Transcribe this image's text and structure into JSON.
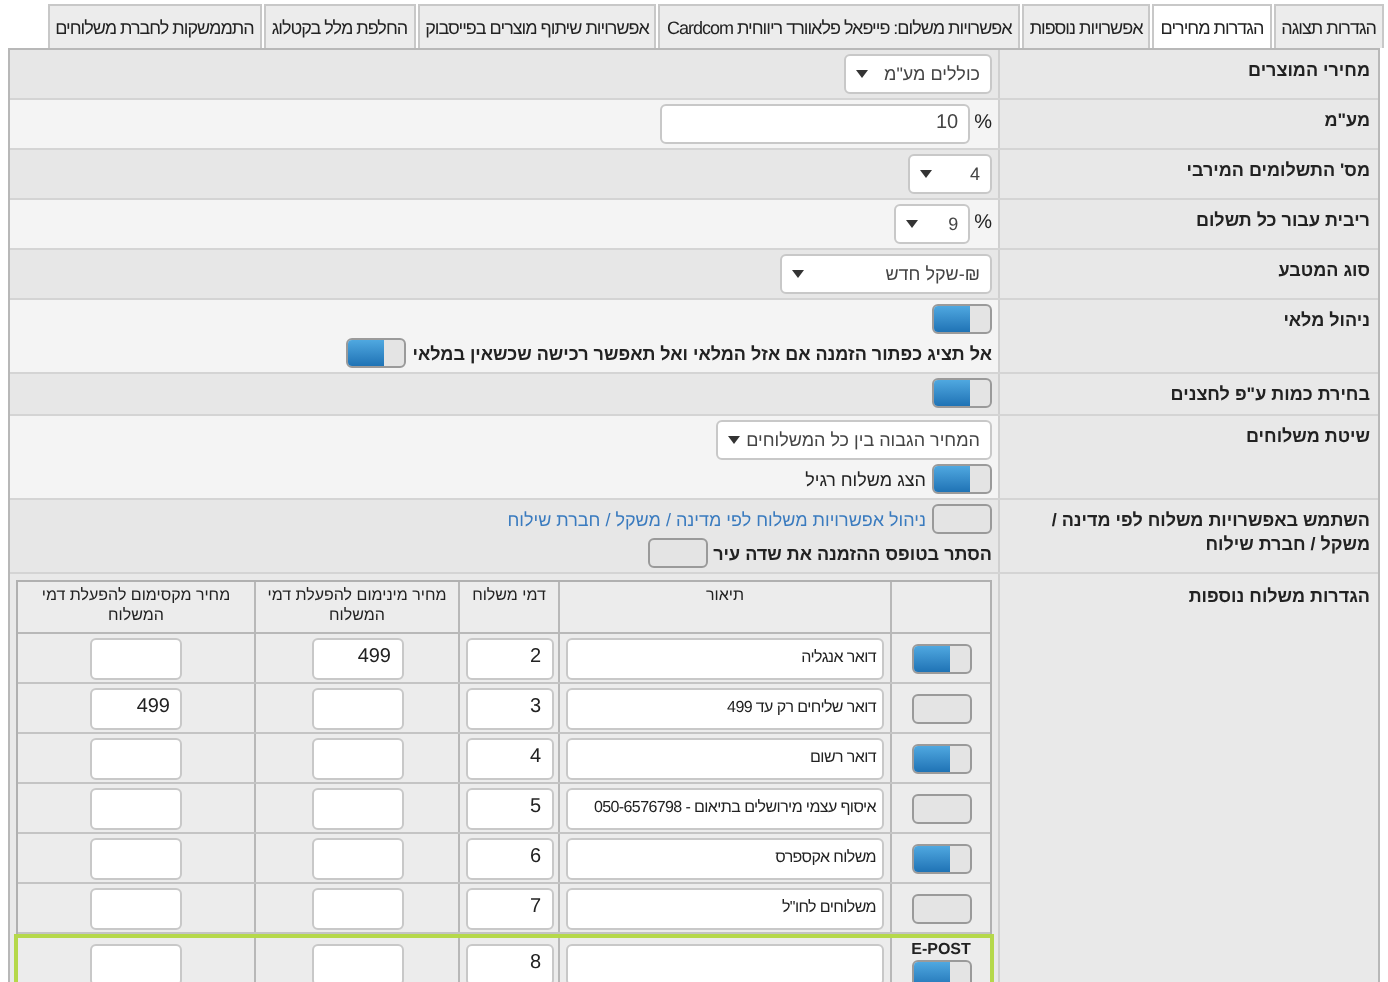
{
  "tabs": [
    {
      "label": "הגדרות תצוגה",
      "selected": false
    },
    {
      "label": "הגדרות מחירים",
      "selected": true
    },
    {
      "label": "אפשרויות נוספות",
      "selected": false
    },
    {
      "label": "אפשרויות משלום: פייפאל פלאוורד ריווחית Cardcom",
      "selected": false
    },
    {
      "label": "אפשרויות שיתוף מוצרים בפייסבוק",
      "selected": false
    },
    {
      "label": "החלפת מלל בקטלוג",
      "selected": false
    },
    {
      "label": "התממשקות לחברת משלוחים",
      "selected": false
    }
  ],
  "settings": [
    {
      "label": "מחירי המוצרים",
      "controls": [
        {
          "kind": "select",
          "value": "כוללים מע\"מ"
        }
      ]
    },
    {
      "label": "מע\"מ",
      "controls": [
        {
          "kind": "input",
          "value": "10",
          "unit": "%"
        }
      ]
    },
    {
      "label": "מס' התשלומים המירבי",
      "controls": [
        {
          "kind": "select",
          "value": "4"
        }
      ]
    },
    {
      "label": "ריבית עבור כל תשלום",
      "controls": [
        {
          "kind": "select",
          "value": "9",
          "unit": "%"
        }
      ]
    },
    {
      "label": "סוג המטבע",
      "controls": [
        {
          "kind": "select",
          "value": "₪-שקל חדש"
        }
      ]
    },
    {
      "label": "ניהול מלאי",
      "controls": [
        {
          "kind": "toggle",
          "on": true
        },
        {
          "kind": "text_toggle",
          "on": true,
          "text": "אל תציג כפתור הזמנה אם אזל המלאי ואל תאפשר רכישה שכשאין במלאי"
        }
      ]
    },
    {
      "label": "בחירת כמות ע\"פ לחצנים",
      "controls": [
        {
          "kind": "toggle",
          "on": true
        }
      ]
    },
    {
      "label": "שיטת משלוחים",
      "controls": [
        {
          "kind": "select",
          "value": "המחיר הגבוה בין כל המשלוחים"
        },
        {
          "kind": "toggle",
          "on": true,
          "text": "הצג משלוח רגיל"
        }
      ]
    },
    {
      "label": "השתמש באפשרויות משלוח לפי מדינה / משקל / חברת שילוח",
      "controls": [
        {
          "kind": "toggle",
          "on": false,
          "link": "ניהול אפשרויות משלוח לפי מדינה / משקל / חברת שילוח"
        },
        {
          "kind": "text_toggle",
          "on": false,
          "text": "הסתר בטופס ההזמנה את שדה עיר"
        }
      ]
    }
  ],
  "shipping": {
    "label": "הגדרות משלוח נוספות",
    "columns": [
      "תיאור",
      "דמי משלוח",
      "מחיר מינימום להפעלת דמי המשלוח",
      "מחיר מקסימום להפעלת דמי המשלוח"
    ],
    "rows": [
      {
        "on": true,
        "description": "דואר אנגליה",
        "fee": "2",
        "min": "499"
      },
      {
        "on": false,
        "description": "דואר שליחים רק עד 499",
        "fee": "3",
        "max": "499"
      },
      {
        "on": true,
        "description": "דואר רשום",
        "fee": "4"
      },
      {
        "on": false,
        "description": "איסוף עצמי מירושלים בתיאום - 050-6576798",
        "fee": "5"
      },
      {
        "on": true,
        "description": "משלוח אקספרס",
        "fee": "6"
      },
      {
        "on": false,
        "description": "משלוחים לחו\"ל",
        "fee": "7"
      },
      {
        "on": true,
        "name": "E-POST",
        "fee": "8",
        "highlighted": true
      }
    ]
  }
}
